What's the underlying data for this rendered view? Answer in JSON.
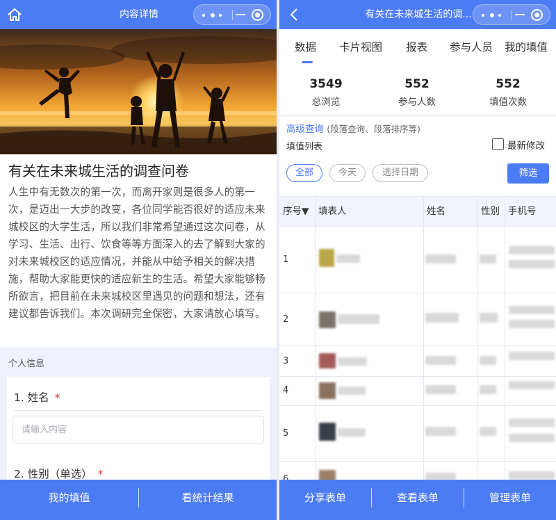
{
  "left_panel": {
    "header_title": "内容详情",
    "survey_title": "有关在未来城生活的调查问卷",
    "survey_description": "人生中有无数次的第一次，而离开家则是很多人的第一次，是迈出一大步的改变，各位同学能否很好的适应未来城校区的大学生活，所以我们非常希望通过这次问卷，从学习、生活、出行、饮食等等方面深入的去了解到大家的对未来城校区的适应情况，并能从中给予相关的解决措施，帮助大家能更快的适应新生的生活。希望大家能够畅所欲言，把目前在未来城校区里遇见的问题和想法，还有建议都告诉我们。本次调研完全保密，大家请放心填写。",
    "section_label": "个人信息",
    "questions": [
      {
        "label": "1. 姓名",
        "required_mark": "*",
        "placeholder": "请输入内容"
      },
      {
        "label": "2. 性别（单选）",
        "required_mark": "*"
      }
    ],
    "bottom_buttons": [
      "我的填值",
      "看统计结果"
    ]
  },
  "right_panel": {
    "header_title": "有关在未来城生活的调...",
    "tabs": [
      "数据",
      "卡片视图",
      "报表",
      "参与人员",
      "我的填值"
    ],
    "active_tab": "数据",
    "stats": [
      {
        "value": "3549",
        "label": "总浏览"
      },
      {
        "value": "552",
        "label": "参与人数"
      },
      {
        "value": "552",
        "label": "填值次数"
      }
    ],
    "advanced_query": "高级查询",
    "advanced_query_note": "(段落查询、段落排序等)",
    "fill_list_label": "填值列表",
    "latest_modified_label": "最新修改",
    "filter_chips": [
      "全部",
      "今天",
      "选择日期"
    ],
    "active_chip": "全部",
    "filter_button": "筛选",
    "table": {
      "headers": [
        "序号▼",
        "填表人",
        "姓名",
        "性别",
        "手机号"
      ],
      "row_numbers": [
        "1",
        "2",
        "3",
        "4",
        "5",
        "6"
      ]
    },
    "bottom_buttons": [
      "分享表单",
      "查看表单",
      "管理表单"
    ]
  },
  "colors": {
    "primary": "#4c7cf3",
    "required": "#e23b3b",
    "sunset_sky": "#f0a030"
  },
  "icons": [
    "home-icon",
    "back-icon",
    "more-dots-icon",
    "minimize-icon",
    "close-target-icon"
  ]
}
